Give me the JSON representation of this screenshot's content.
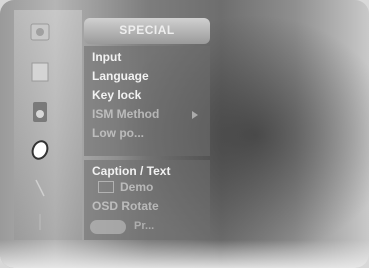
{
  "menu": {
    "title": "SPECIAL",
    "items": [
      "Input",
      "Language",
      "Key lock",
      "ISM Method",
      "Low po..."
    ],
    "caption": "Caption / Text",
    "demo": "Demo",
    "rotate": "OSD Rotate",
    "footer_label": "Pr..."
  },
  "icons": [
    "picture-icon",
    "screen-icon",
    "speaker-icon",
    "clock-icon",
    "special-icon",
    "antenna-icon"
  ],
  "colors": {
    "panel": "#6e6e6e",
    "text": "#f2f2f2",
    "background": "#8a8a8a"
  }
}
